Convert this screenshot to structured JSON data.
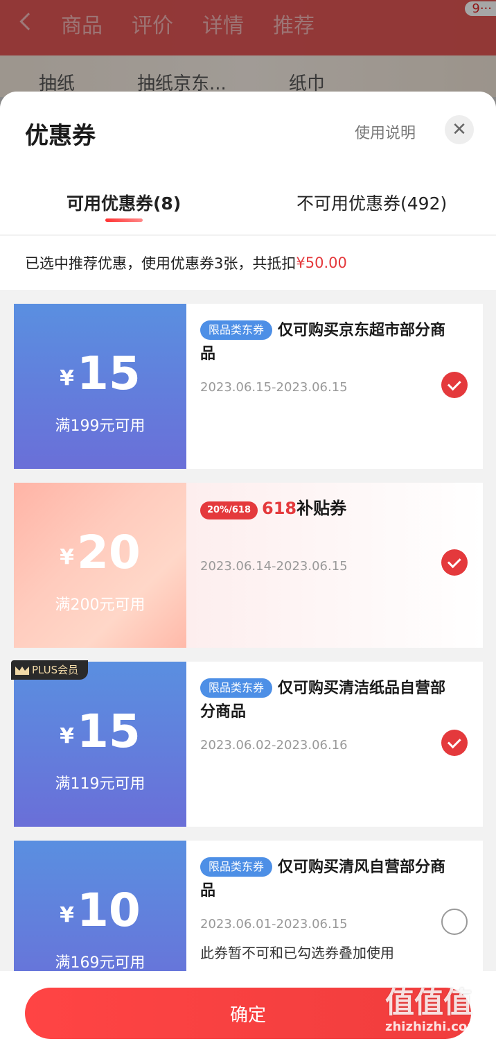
{
  "background": {
    "tabs": [
      "商品",
      "评价",
      "详情",
      "推荐"
    ],
    "badge": "9···",
    "row": [
      "抽纸",
      "抽纸京东...",
      "纸巾"
    ]
  },
  "sheet": {
    "title": "优惠券",
    "help_link": "使用说明",
    "close_symbol": "✕",
    "tabs": {
      "available": "可用优惠券(8)",
      "unavailable": "不可用优惠券(492)"
    },
    "summary_prefix": "已选中推荐优惠，使用优惠券3张，共抵扣",
    "summary_amount": "¥50.00"
  },
  "coupons": [
    {
      "yen": "¥",
      "amount": "15",
      "condition": "满199元可用",
      "tag": "限品类东券",
      "description": "仅可购买京东超市部分商品",
      "dates": "2023.06.15-2023.06.15",
      "checked": true
    },
    {
      "yen": "¥",
      "amount": "20",
      "condition": "满200元可用",
      "badge": "20%/618",
      "badge_618": "618",
      "badge_text": "补贴券",
      "dates": "2023.06.14-2023.06.15",
      "checked": true
    },
    {
      "plus_label": "PLUS会员",
      "yen": "¥",
      "amount": "15",
      "condition": "满119元可用",
      "tag": "限品类东券",
      "description": "仅可购买清洁纸品自营部分商品",
      "dates": "2023.06.02-2023.06.16",
      "checked": true
    },
    {
      "yen": "¥",
      "amount": "10",
      "condition": "满169元可用",
      "tag": "限品类东券",
      "description": "仅可购买清风自营部分商品",
      "dates": "2023.06.01-2023.06.15",
      "note": "此券暂不可和已勾选券叠加使用",
      "checked": false
    }
  ],
  "footer": {
    "confirm_label": "确定",
    "watermark_big": "值值值",
    "watermark_small": "zhizhizhi.com"
  },
  "colors": {
    "accent": "#e4393c",
    "coupon_blue": "#5a8fe0",
    "tag_blue": "#4d8fe6"
  }
}
